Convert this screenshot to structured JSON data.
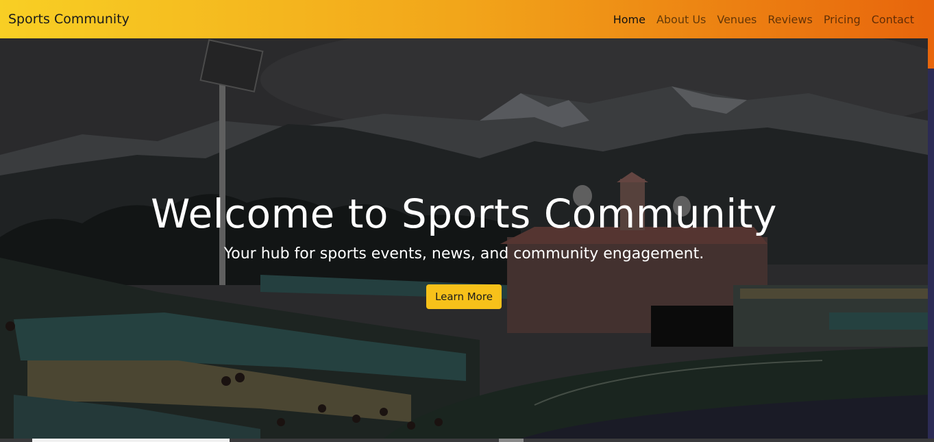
{
  "navbar": {
    "brand": "Sports Community",
    "links": [
      {
        "label": "Home",
        "active": true
      },
      {
        "label": "About Us",
        "active": false
      },
      {
        "label": "Venues",
        "active": false
      },
      {
        "label": "Reviews",
        "active": false
      },
      {
        "label": "Pricing",
        "active": false
      },
      {
        "label": "Contact",
        "active": false
      }
    ],
    "gradient": [
      "#f8cf24",
      "#f2a51a",
      "#e8660c"
    ]
  },
  "hero": {
    "title": "Welcome to Sports Community",
    "subtitle": "Your hub for sports events, news, and community engagement.",
    "button_label": "Learn More",
    "button_color": "#f7c11a",
    "background_image": "cricket-stadium-mountains"
  }
}
